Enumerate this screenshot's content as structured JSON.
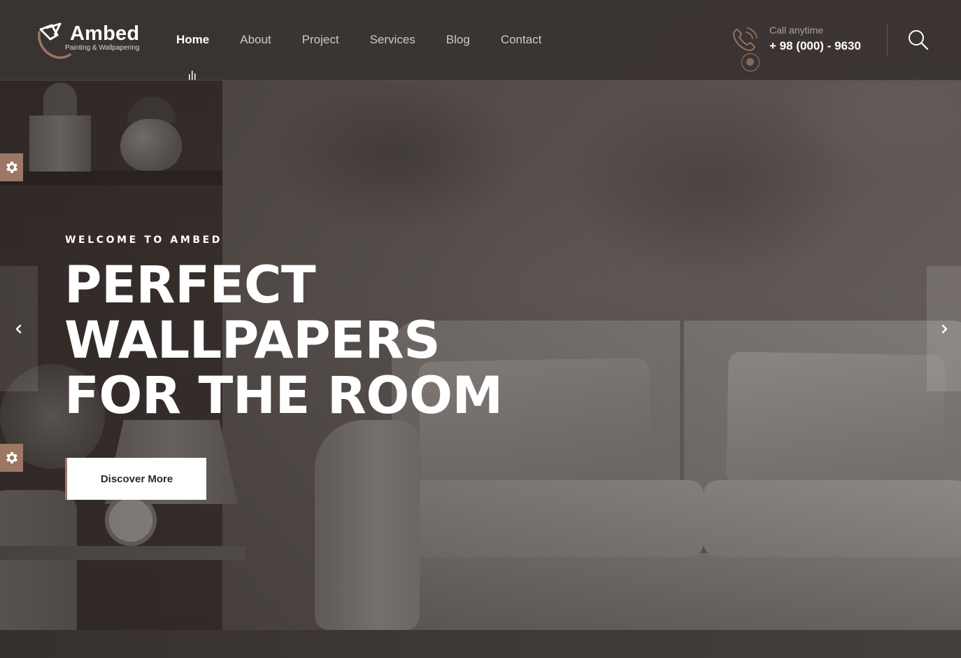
{
  "brand": {
    "name": "Ambed",
    "tagline": "Painting & Wallpapering",
    "accent": "#9b7764",
    "header_bg": "#3a3432"
  },
  "nav": {
    "items": [
      {
        "label": "Home",
        "active": true
      },
      {
        "label": "About",
        "active": false
      },
      {
        "label": "Project",
        "active": false
      },
      {
        "label": "Services",
        "active": false
      },
      {
        "label": "Blog",
        "active": false
      },
      {
        "label": "Contact",
        "active": false
      }
    ]
  },
  "contact": {
    "label": "Call anytime",
    "phone": "+ 98 (000) - 9630",
    "icon": "phone-icon"
  },
  "header_actions": {
    "search_icon": "search-icon"
  },
  "hero": {
    "eyebrow": "WELCOME TO AMBED",
    "title_lines": [
      "PERFECT",
      "WALLPAPERS",
      "FOR THE ROOM"
    ],
    "cta_label": "Discover More"
  },
  "slider": {
    "prev_icon": "chevron-left-icon",
    "next_icon": "chevron-right-icon"
  },
  "side_widgets": {
    "icon": "gear-icon",
    "count": 2
  }
}
